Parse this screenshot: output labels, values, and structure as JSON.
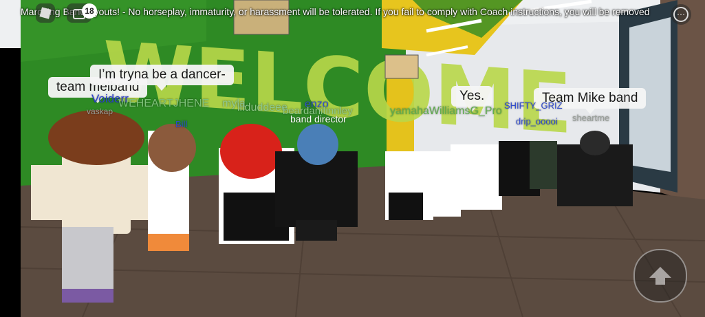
{
  "hud": {
    "announcement": "Marching Band tryouts! - No horseplay, immaturity, or harassment will be tolerated. If you fail to comply with Coach instructions, you will be removed",
    "notification_count": "18",
    "roblox_menu_icon": "roblox-logo-icon",
    "chat_icon": "chat-icon",
    "more_icon": "more-icon",
    "jump_icon": "jump-arrow-icon"
  },
  "scene": {
    "wall_text": "WELCOME",
    "colors": {
      "green_wall": "#2f8a25",
      "yellow": "#e6c21f",
      "floor": "#5a4a3f",
      "white_wall": "#e9ebee"
    }
  },
  "bubbles": {
    "b1": "team melband",
    "b2": "I’m tryna be a dancer-",
    "b3": "Yes.",
    "b4": "Team Mike band"
  },
  "names": {
    "n1": "Voiderr",
    "n2": "WEHEARTJHENE",
    "n3": "myla",
    "n4": "lilduddeee",
    "n5": "enzo",
    "n6": "band director",
    "n7": "beardanifinnley",
    "n8": "yamahaWilliamsG_Pro",
    "n9": "SHIFTY_GRIZ",
    "n10": "drip_ooooi",
    "n11": "sheartme",
    "n12": "Bill",
    "n13": "vaskap"
  }
}
